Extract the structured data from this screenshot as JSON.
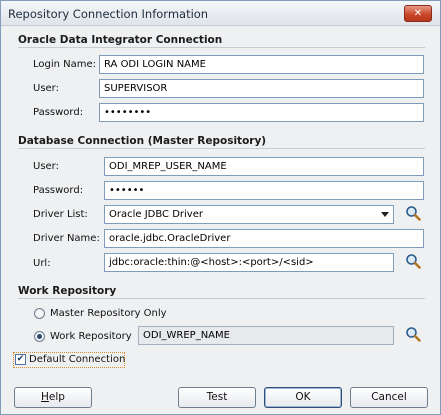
{
  "window": {
    "title": "Repository Connection Information",
    "close_glyph": "✕"
  },
  "odi_section": {
    "heading": "Oracle Data Integrator Connection",
    "login_name": {
      "label": "Login Name:",
      "value": "RA ODI LOGIN NAME"
    },
    "user": {
      "label": "User:",
      "value": "SUPERVISOR"
    },
    "password": {
      "label": "Password:",
      "value": "••••••••"
    }
  },
  "db_section": {
    "heading": "Database Connection (Master Repository)",
    "user": {
      "label": "User:",
      "value": "ODI_MREP_USER_NAME"
    },
    "password": {
      "label": "Password:",
      "value": "••••••"
    },
    "driver_list": {
      "label": "Driver List:",
      "value": "Oracle JDBC Driver"
    },
    "driver_name": {
      "label": "Driver Name:",
      "value": "oracle.jdbc.OracleDriver"
    },
    "url": {
      "label": "Url:",
      "value": "jdbc:oracle:thin:@<host>:<port>/<sid>"
    }
  },
  "work_section": {
    "heading": "Work Repository",
    "master_only_label": "Master Repository Only",
    "work_repo_label": "Work Repository",
    "work_repo_value": "ODI_WREP_NAME"
  },
  "default_connection": {
    "label": "Default Connection",
    "checked": true,
    "check_glyph": "✔"
  },
  "buttons": {
    "help": "Help",
    "test": "Test",
    "ok": "OK",
    "cancel": "Cancel"
  },
  "icons": {
    "search": "magnifier-icon"
  }
}
